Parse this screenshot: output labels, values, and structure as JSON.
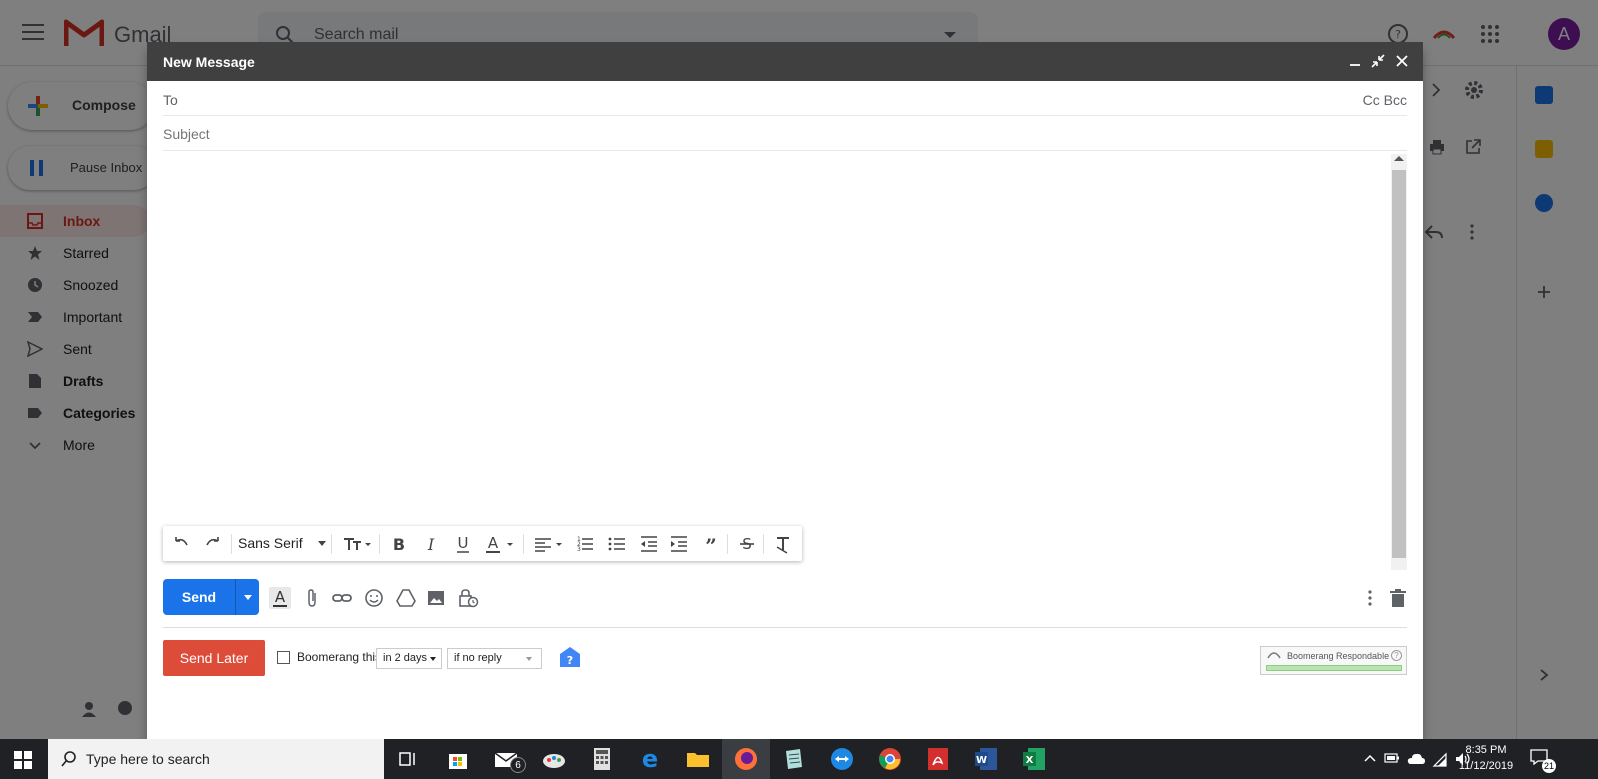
{
  "gmail": {
    "logo_text": "Gmail",
    "search_placeholder": "Search mail",
    "avatar_letter": "A",
    "compose_label": "Compose",
    "pause_inbox_label": "Pause Inbox",
    "nav": [
      {
        "label": "Inbox",
        "icon": "inbox-icon"
      },
      {
        "label": "Starred",
        "icon": "star-icon"
      },
      {
        "label": "Snoozed",
        "icon": "clock-icon"
      },
      {
        "label": "Important",
        "icon": "important-icon"
      },
      {
        "label": "Sent",
        "icon": "send-icon"
      },
      {
        "label": "Drafts",
        "icon": "draft-icon"
      },
      {
        "label": "Categories",
        "icon": "label-icon"
      },
      {
        "label": "More",
        "icon": "chevron-down-icon"
      }
    ]
  },
  "compose": {
    "title": "New Message",
    "to_label": "To",
    "cc_bcc_label": "Cc Bcc",
    "subject_placeholder": "Subject",
    "font_name": "Sans Serif",
    "send_label": "Send",
    "send_later_label": "Send Later",
    "boomerang_label": "Boomerang this",
    "boomerang_when": "in 2 days",
    "boomerang_condition": "if no reply",
    "respondable_label": "Boomerang Respondable"
  },
  "taskbar": {
    "search_text": "Type here to search",
    "mail_badge": "6",
    "time": "8:35 PM",
    "date": "11/12/2019",
    "notification_count": "21"
  },
  "colors": {
    "gmail_red": "#d93025",
    "send_blue": "#1a73e8",
    "send_later_red": "#dd4b39",
    "header_dark": "#404040",
    "taskbar": "#1f2124"
  }
}
